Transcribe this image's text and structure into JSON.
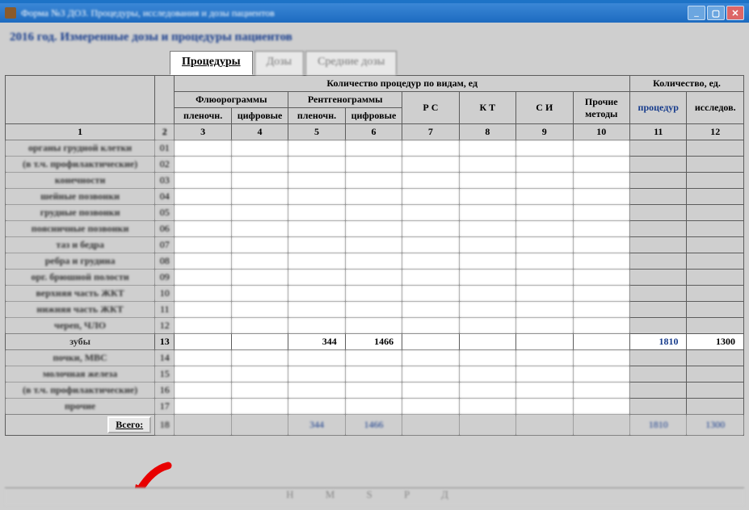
{
  "window": {
    "title": "Форма №3 ДОЗ. Процедуры, исследования и дозы пациентов"
  },
  "subtitle": "2016 год.   Измеренные дозы и процедуры пациентов",
  "tabs": {
    "t0": "Процедуры",
    "t1": "Дозы",
    "t2": "Средние дозы"
  },
  "header": {
    "group_qty_by_type": "Количество процедур по видам, ед",
    "group_qty": "Количество, ед.",
    "fluoro": "Флюорограммы",
    "radio": "Рентгенограммы",
    "film": "пленочн.",
    "digital": "цифровые",
    "rc": "Р С",
    "kt": "К Т",
    "si": "С И",
    "other": "Прочие методы",
    "procedures": "процедур",
    "studies": "исследов.",
    "col1": "1",
    "col2": "2",
    "c3": "3",
    "c4": "4",
    "c5": "5",
    "c6": "6",
    "c7": "7",
    "c8": "8",
    "c9": "9",
    "c10": "10",
    "c11": "11",
    "c12": "12"
  },
  "rows": {
    "r1": {
      "name": "органы грудной клетки",
      "num": "01"
    },
    "r2": {
      "name": "(в т.ч. профилактические)",
      "num": "02"
    },
    "r3": {
      "name": "конечности",
      "num": "03"
    },
    "r4": {
      "name": "шейные позвонки",
      "num": "04"
    },
    "r5": {
      "name": "грудные позвонки",
      "num": "05"
    },
    "r6": {
      "name": "поясничные позвонки",
      "num": "06"
    },
    "r7": {
      "name": "таз и бедра",
      "num": "07"
    },
    "r8": {
      "name": "ребра и грудина",
      "num": "08"
    },
    "r9": {
      "name": "орг. брюшной полости",
      "num": "09"
    },
    "r10": {
      "name": "верхняя часть ЖКТ",
      "num": "10"
    },
    "r11": {
      "name": "нижняя часть ЖКТ",
      "num": "11"
    },
    "r12": {
      "name": "череп, ЧЛО",
      "num": "12"
    },
    "r13": {
      "name": "зубы",
      "num": "13",
      "v5": "344",
      "v6": "1466",
      "v11": "1810",
      "v12": "1300"
    },
    "r14": {
      "name": "почки, МВС",
      "num": "14"
    },
    "r15": {
      "name": "молочная железа",
      "num": "15"
    },
    "r16": {
      "name": "(в т.ч. профилактические)",
      "num": "16"
    },
    "r17": {
      "name": "прочие",
      "num": "17"
    },
    "total": {
      "label": "Всего:",
      "num": "18",
      "v5": "344",
      "v6": "1466",
      "v11": "1810",
      "v12": "1300"
    }
  },
  "footer": "Н   М   S   P   Д"
}
